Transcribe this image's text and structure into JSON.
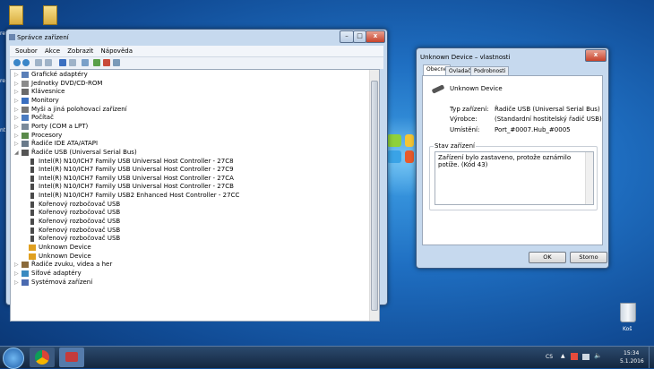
{
  "colors": {
    "accent": "#1f6fc2",
    "titlebar": "#c6d9ee"
  },
  "desktop": {
    "left_labels": [
      "re",
      "re",
      "nt"
    ],
    "recycle_bin": "Koš"
  },
  "main_window": {
    "title": "Správce zařízení",
    "menu": [
      "Soubor",
      "Akce",
      "Zobrazit",
      "Nápověda"
    ],
    "tree": [
      {
        "label": "Grafické adaptéry",
        "indent": 0,
        "arrow": "▷",
        "icon": "display-adapter-icon"
      },
      {
        "label": "Jednotky DVD/CD-ROM",
        "indent": 0,
        "arrow": "▷",
        "icon": "dvd-drive-icon"
      },
      {
        "label": "Klávesnice",
        "indent": 0,
        "arrow": "▷",
        "icon": "keyboard-icon"
      },
      {
        "label": "Monitory",
        "indent": 0,
        "arrow": "▷",
        "icon": "monitor-icon"
      },
      {
        "label": "Myši a jiná polohovací zařízení",
        "indent": 0,
        "arrow": "▷",
        "icon": "mouse-icon"
      },
      {
        "label": "Počítač",
        "indent": 0,
        "arrow": "▷",
        "icon": "computer-icon"
      },
      {
        "label": "Porty (COM a LPT)",
        "indent": 0,
        "arrow": "▷",
        "icon": "port-icon"
      },
      {
        "label": "Procesory",
        "indent": 0,
        "arrow": "▷",
        "icon": "processor-icon"
      },
      {
        "label": "Řadiče IDE ATA/ATAPI",
        "indent": 0,
        "arrow": "▷",
        "icon": "ide-controller-icon"
      },
      {
        "label": "Řadiče USB (Universal Serial Bus)",
        "indent": 0,
        "arrow": "◢",
        "icon": "usb-icon"
      },
      {
        "label": "Intel(R) N10/ICH7 Family USB Universal Host Controller - 27C8",
        "indent": 1,
        "arrow": "",
        "icon": "usb-plug-icon"
      },
      {
        "label": "Intel(R) N10/ICH7 Family USB Universal Host Controller - 27C9",
        "indent": 1,
        "arrow": "",
        "icon": "usb-plug-icon"
      },
      {
        "label": "Intel(R) N10/ICH7 Family USB Universal Host Controller - 27CA",
        "indent": 1,
        "arrow": "",
        "icon": "usb-plug-icon"
      },
      {
        "label": "Intel(R) N10/ICH7 Family USB Universal Host Controller - 27CB",
        "indent": 1,
        "arrow": "",
        "icon": "usb-plug-icon"
      },
      {
        "label": "Intel(R) N10/ICH7 Family USB2 Enhanced Host Controller - 27CC",
        "indent": 1,
        "arrow": "",
        "icon": "usb-plug-icon"
      },
      {
        "label": "Kořenový rozbočovač USB",
        "indent": 1,
        "arrow": "",
        "icon": "usb-plug-icon"
      },
      {
        "label": "Kořenový rozbočovač USB",
        "indent": 1,
        "arrow": "",
        "icon": "usb-plug-icon"
      },
      {
        "label": "Kořenový rozbočovač USB",
        "indent": 1,
        "arrow": "",
        "icon": "usb-plug-icon"
      },
      {
        "label": "Kořenový rozbočovač USB",
        "indent": 1,
        "arrow": "",
        "icon": "usb-plug-icon"
      },
      {
        "label": "Kořenový rozbočovač USB",
        "indent": 1,
        "arrow": "",
        "icon": "usb-plug-icon"
      },
      {
        "label": "Unknown Device",
        "indent": 1,
        "arrow": "",
        "icon": "warning-device-icon"
      },
      {
        "label": "Unknown Device",
        "indent": 1,
        "arrow": "",
        "icon": "warning-device-icon"
      },
      {
        "label": "Řadiče zvuku, videa a her",
        "indent": 0,
        "arrow": "▷",
        "icon": "sound-icon"
      },
      {
        "label": "Síťové adaptéry",
        "indent": 0,
        "arrow": "▷",
        "icon": "network-icon"
      },
      {
        "label": "Systémová zařízení",
        "indent": 0,
        "arrow": "▷",
        "icon": "system-icon"
      }
    ]
  },
  "dialog": {
    "title": "Unknown Device – vlastnosti",
    "tabs": [
      "Obecné",
      "Ovladač",
      "Podrobnosti"
    ],
    "device_name": "Unknown Device",
    "props": [
      {
        "label": "Typ zařízení:",
        "value": "Řadiče USB (Universal Serial Bus)"
      },
      {
        "label": "Výrobce:",
        "value": "(Standardní hostitelský řadič USB)"
      },
      {
        "label": "Umístění:",
        "value": "Port_#0007.Hub_#0005"
      }
    ],
    "status_label": "Stav zařízení",
    "status_text": "Zařízení bylo zastaveno, protože oznámilo potíže. (Kód 43)",
    "ok": "OK",
    "cancel": "Storno"
  },
  "taskbar": {
    "lang": "CS",
    "time": "15:34",
    "date": "5.1.2016"
  }
}
